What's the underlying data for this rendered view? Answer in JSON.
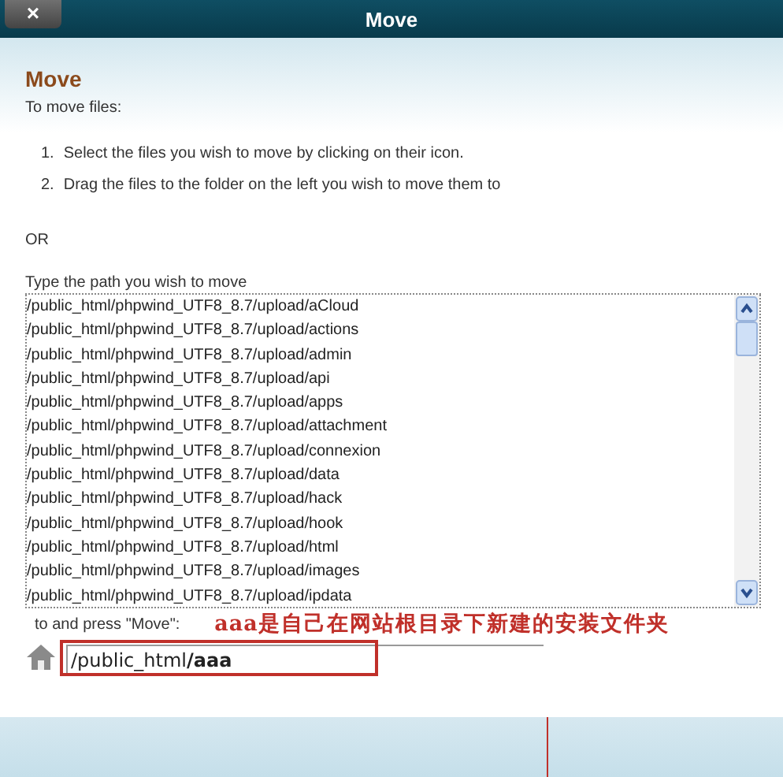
{
  "window": {
    "title": "Move",
    "close_label": "×"
  },
  "heading": "Move",
  "intro": "To move files:",
  "steps": [
    {
      "number": "1.",
      "text": "Select the files you wish to move by clicking on their icon."
    },
    {
      "number": "2.",
      "text": "Drag the files to the folder on the left you wish to move them to"
    }
  ],
  "or_label": "OR",
  "path_label": "Type the path you wish to move",
  "paths": [
    "/public_html/phpwind_UTF8_8.7/upload/aCloud",
    "/public_html/phpwind_UTF8_8.7/upload/actions",
    "/public_html/phpwind_UTF8_8.7/upload/admin",
    "/public_html/phpwind_UTF8_8.7/upload/api",
    "/public_html/phpwind_UTF8_8.7/upload/apps",
    "/public_html/phpwind_UTF8_8.7/upload/attachment",
    "/public_html/phpwind_UTF8_8.7/upload/connexion",
    "/public_html/phpwind_UTF8_8.7/upload/data",
    "/public_html/phpwind_UTF8_8.7/upload/hack",
    "/public_html/phpwind_UTF8_8.7/upload/hook",
    "/public_html/phpwind_UTF8_8.7/upload/html",
    "/public_html/phpwind_UTF8_8.7/upload/images",
    "/public_html/phpwind_UTF8_8.7/upload/ipdata"
  ],
  "destination_label": "to and press \"Move\":",
  "annotation": "aaa是自己在网站根目录下新建的安装文件夹",
  "destination": {
    "value": "/public_html**/aaa**"
  }
}
